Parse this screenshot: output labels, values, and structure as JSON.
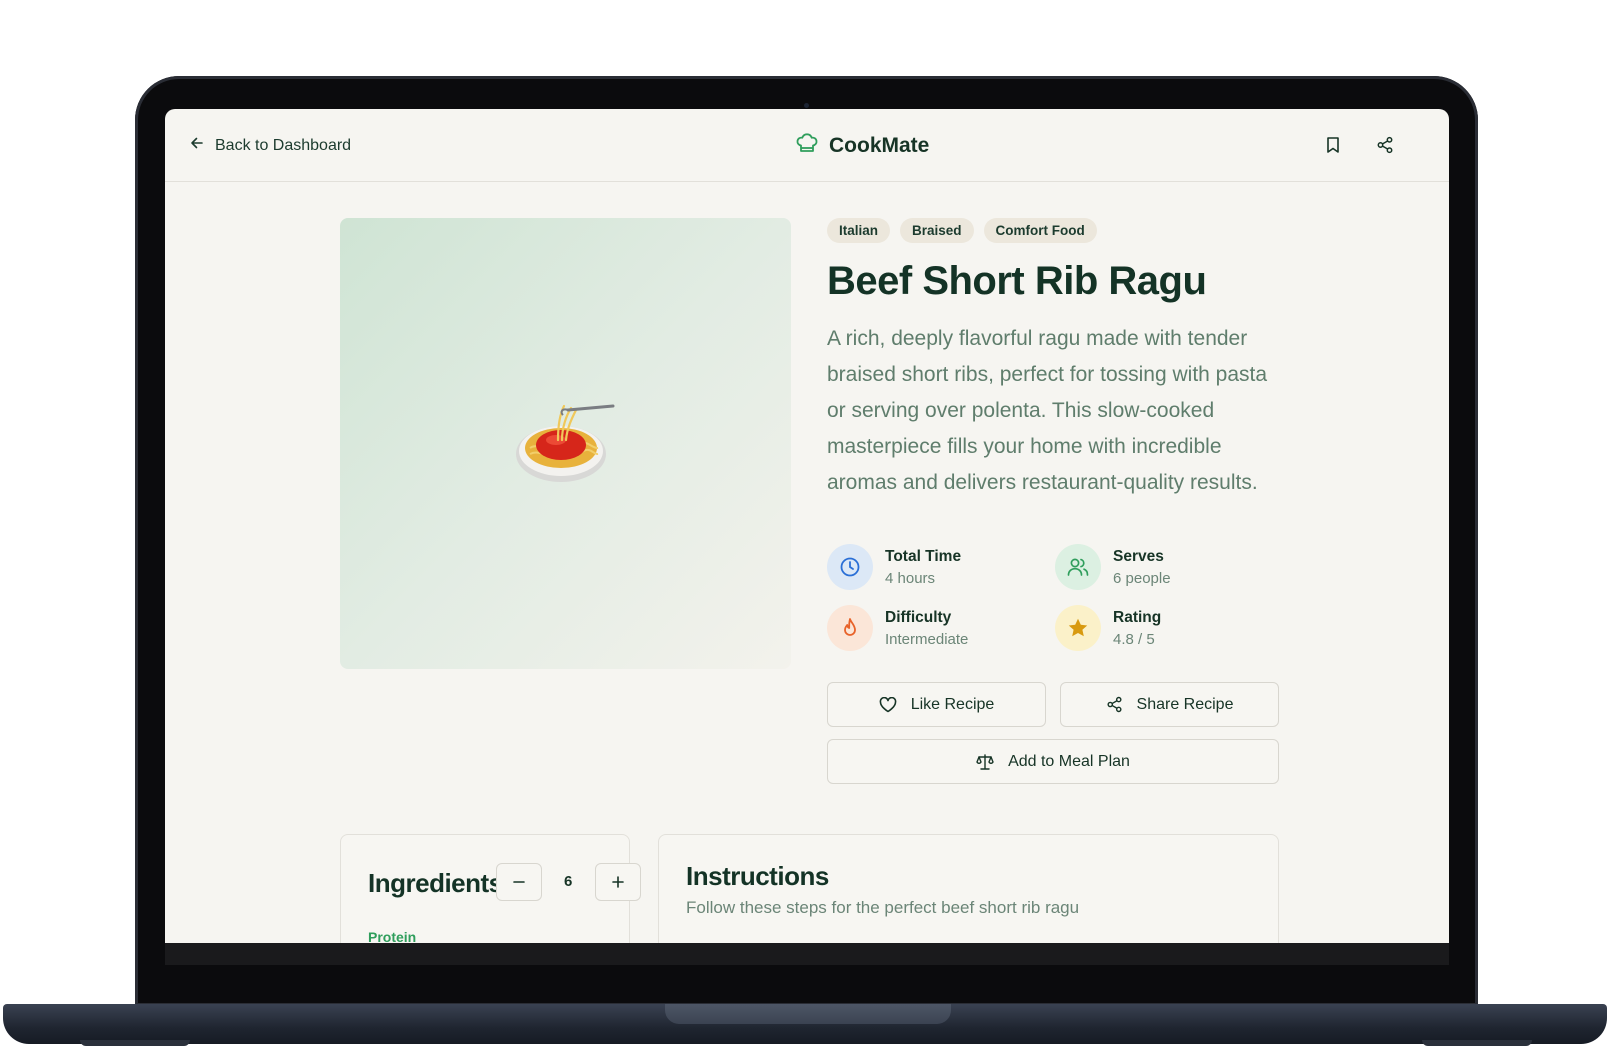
{
  "header": {
    "back_label": "Back to Dashboard",
    "brand_name": "CookMate"
  },
  "recipe": {
    "tags": [
      "Italian",
      "Braised",
      "Comfort Food"
    ],
    "title": "Beef Short Rib Ragu",
    "description": "A rich, deeply flavorful ragu made with tender braised short ribs, perfect for tossing with pasta or serving over polenta. This slow-cooked masterpiece fills your home with incredible aromas and delivers restaurant-quality results.",
    "image_emoji": "🍝",
    "meta": {
      "total_time_label": "Total Time",
      "total_time_value": "4 hours",
      "serves_label": "Serves",
      "serves_value": "6 people",
      "difficulty_label": "Difficulty",
      "difficulty_value": "Intermediate",
      "rating_label": "Rating",
      "rating_value": "4.8 / 5"
    },
    "actions": {
      "like_label": "Like Recipe",
      "share_label": "Share Recipe",
      "meal_plan_label": "Add to Meal Plan"
    }
  },
  "ingredients": {
    "title": "Ingredients",
    "servings": "6",
    "first_section": "Protein"
  },
  "instructions": {
    "title": "Instructions",
    "subtitle": "Follow these steps for the perfect beef short rib ragu"
  },
  "colors": {
    "accent": "#2f9e5c",
    "brand_dark": "#143326",
    "muted_text": "#5f7d6c",
    "background": "#f6f5f1"
  },
  "icons": {
    "back": "arrow-left-icon",
    "brand": "chef-hat-icon",
    "bookmark": "bookmark-icon",
    "share": "share-icon",
    "time": "clock-icon",
    "serves": "users-icon",
    "difficulty": "flame-icon",
    "rating": "star-icon",
    "like": "heart-icon",
    "meal_plan": "scale-icon",
    "minus": "minus-icon",
    "plus": "plus-icon"
  }
}
